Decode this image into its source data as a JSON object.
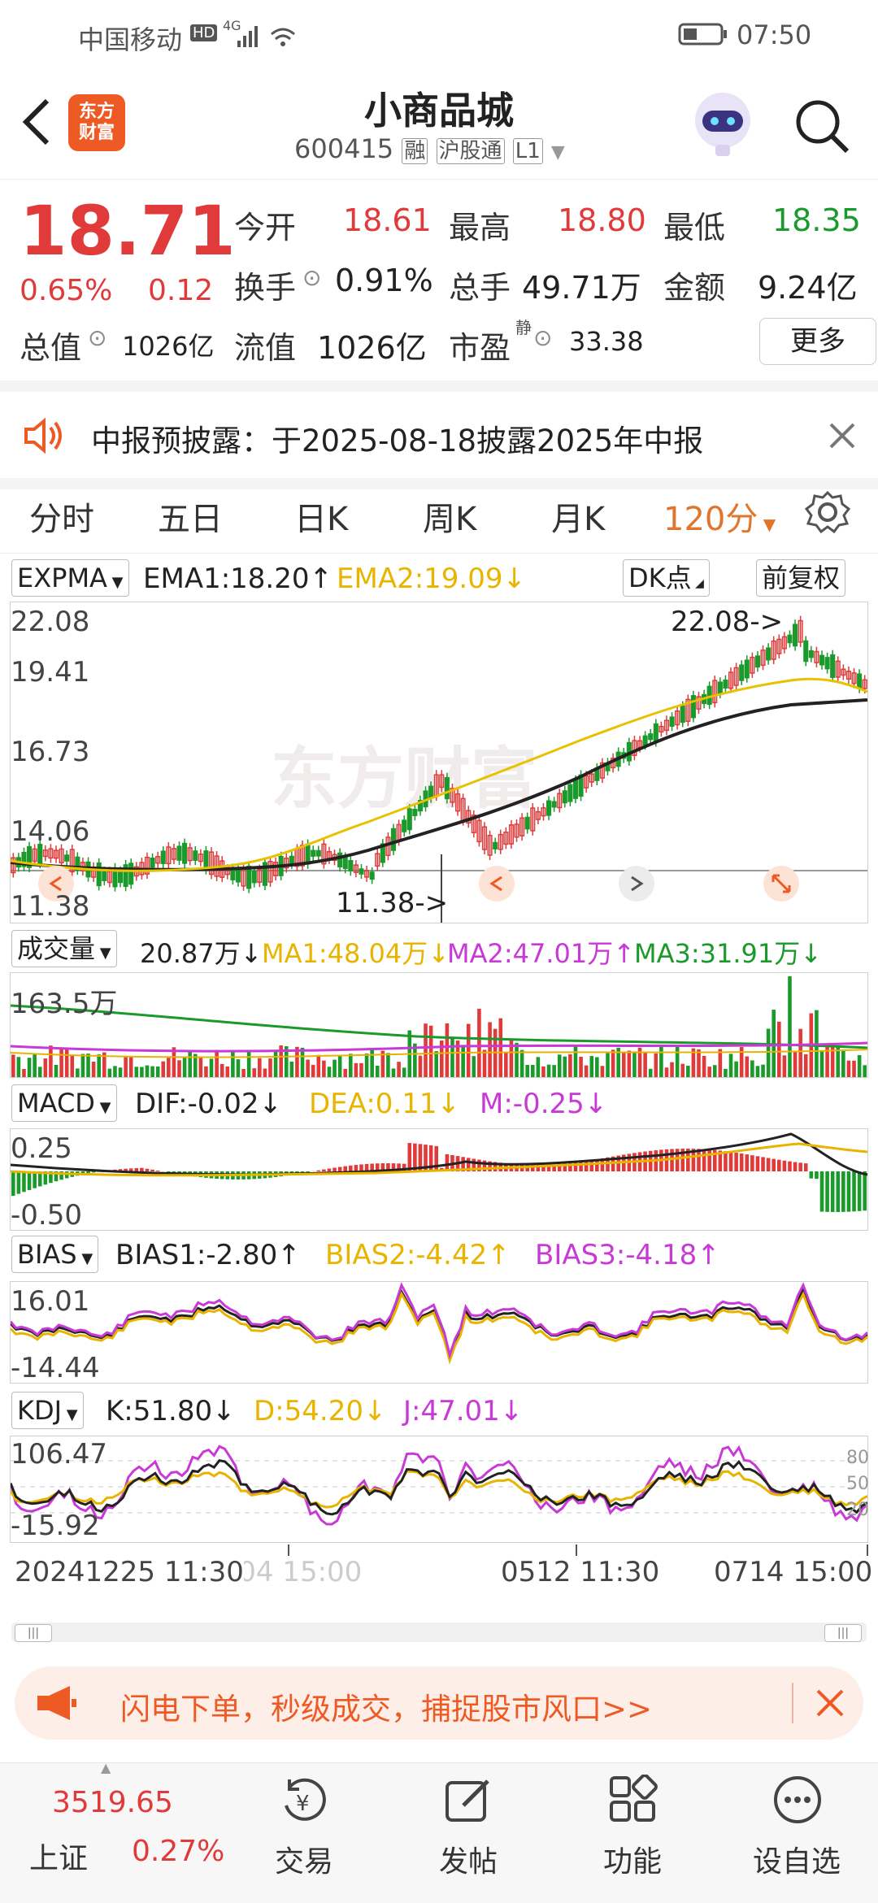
{
  "status_bar": {
    "carrier": "中国移动",
    "hd": "HD",
    "network": "4G",
    "time": "07:50"
  },
  "header": {
    "logo_line1": "东方",
    "logo_line2": "财富",
    "title": "小商品城",
    "code": "600415",
    "badge_margin": "融",
    "badge_connect": "沪股通",
    "badge_level": "L1"
  },
  "quote": {
    "price": "18.71",
    "change_pct": "0.65%",
    "change": "0.12",
    "open_label": "今开",
    "open": "18.61",
    "high_label": "最高",
    "high": "18.80",
    "low_label": "最低",
    "low": "18.35",
    "turnover_label": "换手",
    "turnover": "0.91%",
    "volume_label": "总手",
    "volume": "49.71万",
    "amount_label": "金额",
    "amount": "9.24亿",
    "mktcap_label": "总值",
    "mktcap": "1026亿",
    "float_label": "流值",
    "float_cap": "1026亿",
    "pe_label": "市盈",
    "pe_sup": "静",
    "pe": "33.38",
    "more_label": "更多"
  },
  "notice": {
    "text": "中报预披露：于2025-08-18披露2025年中报"
  },
  "tabs": [
    "分时",
    "五日",
    "日K",
    "周K",
    "月K",
    "120分"
  ],
  "kline": {
    "indicator": "EXPMA",
    "ema1": "EMA1:18.20↑",
    "ema2": "EMA2:19.09↓",
    "dk_label": "DK点",
    "fq_label": "前复权",
    "y_labels": [
      "22.08",
      "19.41",
      "16.73",
      "14.06",
      "11.38"
    ],
    "max_marker": "22.08->",
    "min_marker": "11.38->",
    "watermark": "东方财富"
  },
  "volume": {
    "indicator": "成交量",
    "value": "20.87万↓",
    "ma1": "MA1:48.04万↓",
    "ma2": "MA2:47.01万↑",
    "ma3": "MA3:31.91万↓",
    "max_label": "163.5万"
  },
  "macd": {
    "indicator": "MACD",
    "dif": "DIF:-0.02↓",
    "dea": "DEA:0.11↓",
    "m": "M:-0.25↓",
    "top": "0.25",
    "bottom": "-0.50"
  },
  "bias": {
    "indicator": "BIAS",
    "b1": "BIAS1:-2.80↑",
    "b2": "BIAS2:-4.42↑",
    "b3": "BIAS3:-4.18↑",
    "top": "16.01",
    "bottom": "-14.44"
  },
  "kdj": {
    "indicator": "KDJ",
    "k": "K:51.80↓",
    "d": "D:54.20↓",
    "j": "J:47.01↓",
    "top": "106.47",
    "bottom": "-15.92",
    "lv80": "80",
    "lv50": "50",
    "lv20": "20"
  },
  "time_axis": {
    "t1": "20241225 11:30",
    "t1b": "0304 15:00",
    "t2": "0512 11:30",
    "t3": "0714 15:00"
  },
  "ad": {
    "text": "闪电下单，秒级成交，捕捉股市风口>>"
  },
  "tabbar": {
    "index_value": "3519.65",
    "index_name": "上证",
    "index_change": "0.27%",
    "items": [
      "交易",
      "发帖",
      "功能",
      "设自选"
    ]
  }
}
